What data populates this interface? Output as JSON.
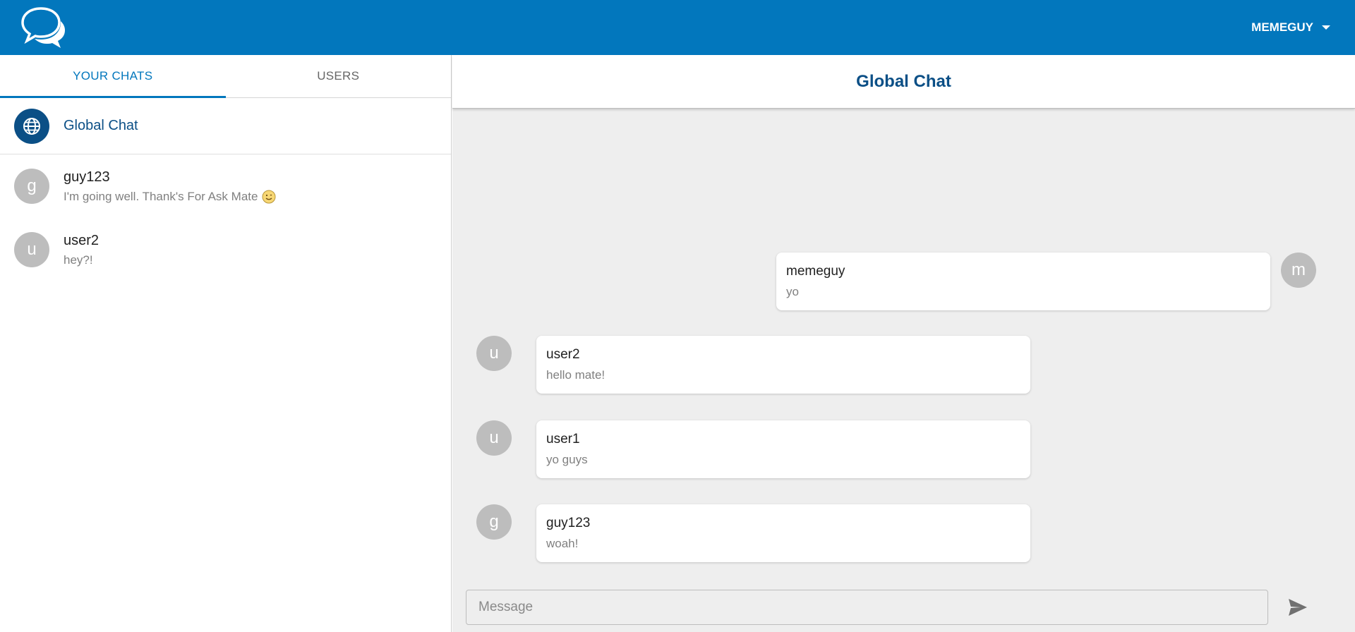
{
  "header": {
    "logo_icon": "chat-bubbles-icon",
    "username": "MEMEGUY",
    "dropdown_icon": "caret-down-icon",
    "bg_color": "#0277bd"
  },
  "sidebar": {
    "tabs": [
      {
        "label": "YOUR CHATS",
        "active": true
      },
      {
        "label": "USERS",
        "active": false
      }
    ],
    "chats": [
      {
        "name": "Global Chat",
        "avatar_icon": "globe-icon",
        "preview": ""
      },
      {
        "name": "guy123",
        "avatar_letter": "g",
        "preview": "I'm going well. Thank's For Ask Mate",
        "preview_emoji": "smile-emoji-icon"
      },
      {
        "name": "user2",
        "avatar_letter": "u",
        "preview": "hey?!"
      }
    ]
  },
  "main": {
    "title": "Global Chat",
    "messages": [
      {
        "sender": "memeguy",
        "avatar_letter": "m",
        "text": "yo",
        "side": "right"
      },
      {
        "sender": "user2",
        "avatar_letter": "u",
        "text": "hello mate!",
        "side": "left"
      },
      {
        "sender": "user1",
        "avatar_letter": "u",
        "text": "yo guys",
        "side": "left"
      },
      {
        "sender": "guy123",
        "avatar_letter": "g",
        "text": "woah!",
        "side": "left"
      }
    ],
    "composer": {
      "placeholder": "Message",
      "value": "",
      "send_icon": "send-icon"
    }
  }
}
